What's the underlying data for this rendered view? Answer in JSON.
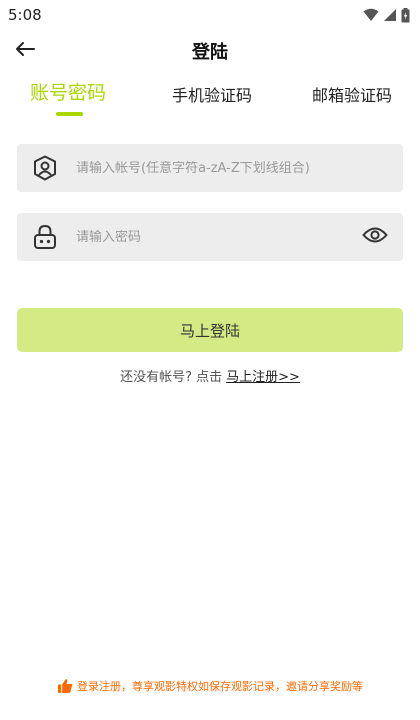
{
  "status_bar": {
    "time": "5:08"
  },
  "header": {
    "title": "登陆"
  },
  "tabs": [
    {
      "label": "账号密码"
    },
    {
      "label": "手机验证码"
    },
    {
      "label": "邮箱验证码"
    }
  ],
  "account_field": {
    "placeholder": "请输入帐号(任意字符a-zA-Z下划线组合)",
    "value": ""
  },
  "password_field": {
    "placeholder": "请输入密码",
    "value": ""
  },
  "login_button": {
    "label": "马上登陆"
  },
  "register": {
    "prompt": "还没有帐号? 点击",
    "link": "马上注册>>"
  },
  "footer": {
    "note": "登录注册，尊享观影特权如保存观影记录，邀请分享奖励等"
  },
  "colors": {
    "accent": "#a8d800",
    "button_bg": "#d3ea85",
    "footer_text": "#ff6a00",
    "field_bg": "#ededed"
  }
}
